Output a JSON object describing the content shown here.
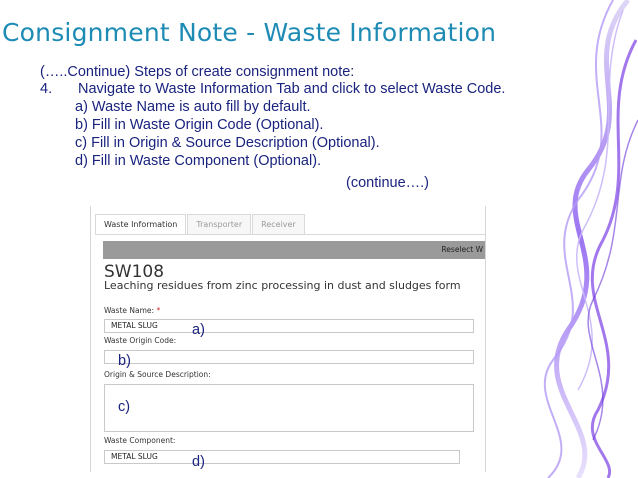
{
  "title": "Consignment Note - Waste Information",
  "steps": {
    "intro": "(…..Continue) Steps of create consignment note:",
    "num": "4.",
    "main": "Navigate to Waste Information Tab and click to select Waste Code.",
    "a": "a) Waste Name is auto fill by default.",
    "b": "b) Fill in Waste Origin Code (Optional).",
    "c": "c) Fill in Origin & Source Description (Optional).",
    "d": "d) Fill in Waste Component (Optional).",
    "cont": "(continue….)"
  },
  "screenshot": {
    "tabs": [
      "Waste Information",
      "Transporter",
      "Receiver"
    ],
    "reselect_label": "Reselect W",
    "waste_code": "SW108",
    "waste_desc": "Leaching residues from zinc processing in dust and sludges form",
    "waste_name_label": "Waste Name:",
    "required_mark": "*",
    "waste_name_value": "METAL SLUG",
    "origin_code_label": "Waste Origin Code:",
    "origin_desc_label": "Origin & Source Description:",
    "component_label": "Waste Component:",
    "component_value": "METAL SLUG"
  },
  "annotations": {
    "a": "a)",
    "b": "b)",
    "c": "c)",
    "d": "d)"
  },
  "colors": {
    "title": "#1d8bb4",
    "body_text": "#1a237e",
    "bar": "#9a9a9a",
    "required": "#d02b2b"
  }
}
